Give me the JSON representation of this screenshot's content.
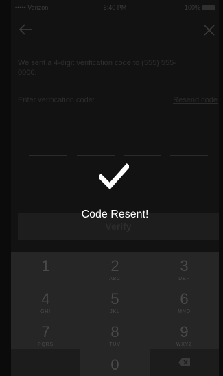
{
  "status": {
    "carrier": "••••• Verizon",
    "time": "5:40 PM",
    "battery": "100%"
  },
  "nav": {
    "back_icon": "arrow-left-icon",
    "close_icon": "close-icon"
  },
  "message": "We sent a 4-digit verification code to (555) 555-0000.",
  "code_label": "Enter verification code:",
  "resend_label": "Resend code",
  "verify_label": "Verify",
  "toast": {
    "icon": "checkmark-icon",
    "title": "Code Resent!"
  },
  "keypad": [
    {
      "num": "1",
      "letters": ""
    },
    {
      "num": "2",
      "letters": "ABC"
    },
    {
      "num": "3",
      "letters": "DEF"
    },
    {
      "num": "4",
      "letters": "GHI"
    },
    {
      "num": "5",
      "letters": "JKL"
    },
    {
      "num": "6",
      "letters": "MNO"
    },
    {
      "num": "7",
      "letters": "PQRS"
    },
    {
      "num": "8",
      "letters": "TUV"
    },
    {
      "num": "9",
      "letters": "WXYZ"
    },
    {
      "num": "0",
      "letters": ""
    }
  ],
  "colors": {
    "background": "#121212",
    "keypad": "#262626",
    "toast_text": "#ffffff"
  }
}
